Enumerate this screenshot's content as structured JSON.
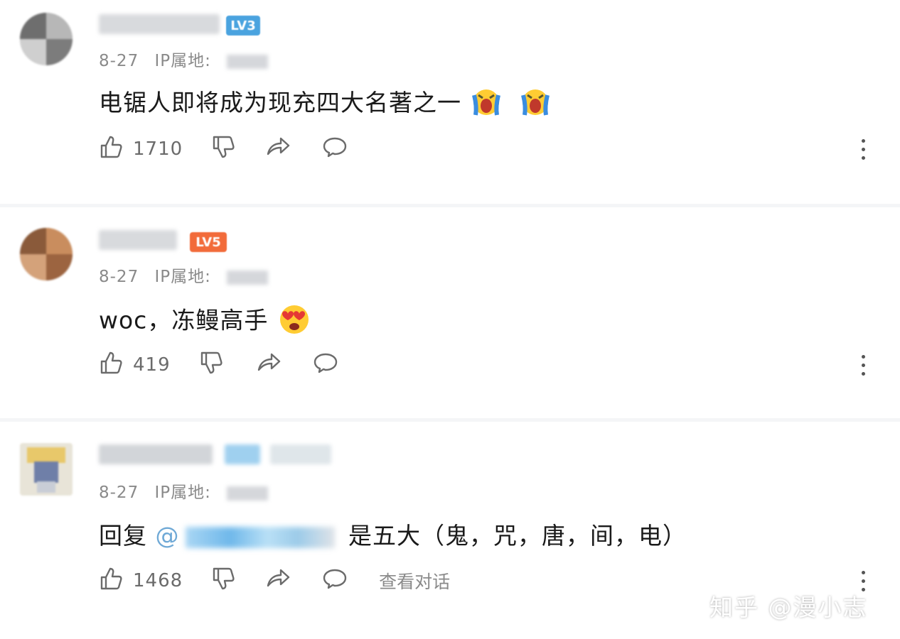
{
  "comments": [
    {
      "date": "8-27",
      "ip_label": "IP属地",
      "ip_sep": ":",
      "text_before": "电锯人即将成为现充四大名著之一",
      "emojis": [
        "crying-emoji",
        "crying-emoji"
      ],
      "likes": "1710",
      "level_badge": "LV3"
    },
    {
      "date": "8-27",
      "ip_label": "IP属地",
      "ip_sep": ":",
      "text_before": "woc，冻鳗高手",
      "emojis": [
        "heart-eyes-emoji"
      ],
      "likes": "419",
      "level_badge": "LV5"
    },
    {
      "date": "8-27",
      "ip_label": "IP属地",
      "ip_sep": ":",
      "reply_prefix": "回复",
      "mention_at": "@",
      "text_after": "是五大（鬼，咒，唐，间，电）",
      "likes": "1468",
      "view_conversation": "查看对话"
    }
  ],
  "watermark": "知乎 @漫小志",
  "colors": {
    "background": "#f4f5f7",
    "card": "#ffffff",
    "meta_text": "#8a8a8a",
    "action_text": "#6b6b6b",
    "badge_lv5": "#f26b3a",
    "badge_lv3": "#4aa3df"
  },
  "icons": [
    "thumbs-up-icon",
    "thumbs-down-icon",
    "share-icon",
    "comment-icon",
    "more-vertical-icon"
  ]
}
